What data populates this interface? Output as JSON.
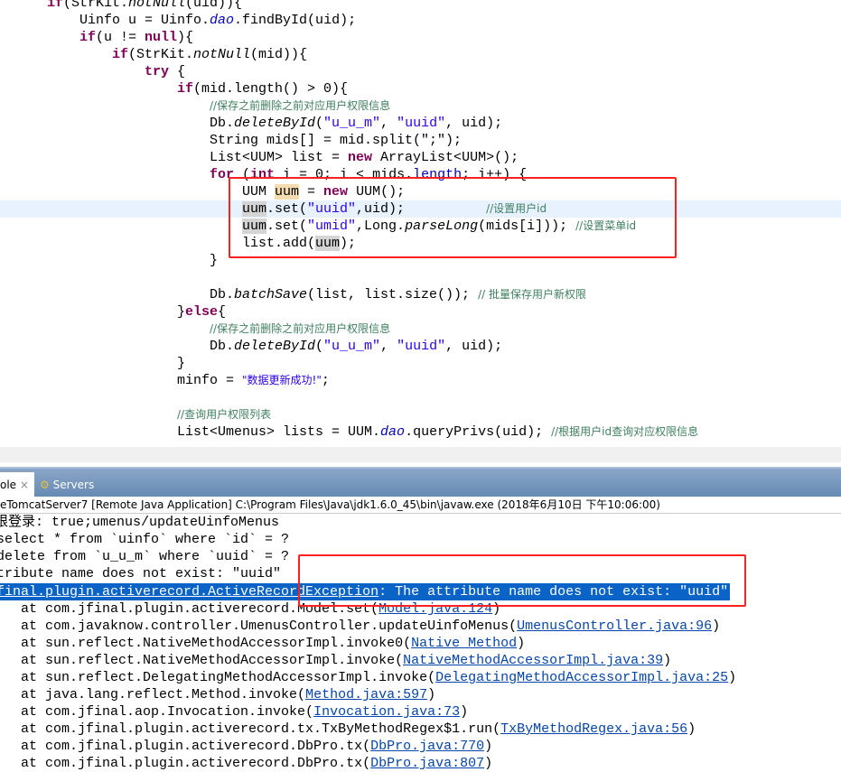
{
  "code": {
    "l0": "if(StrKit.notNull(uid)){",
    "l1": "Uinfo u = Uinfo.dao.findById(uid);",
    "l3": "if(StrKit.notNull(mid)){",
    "l6": "//保存之前删除之前对应用户权限信息",
    "l8": "String mids[] = mid.split(\";\");",
    "l11c": "//设置用户id",
    "l12c": "//设置菜单id",
    "l16c": "// 批量保存用户新权限",
    "l18": "//保存之前删除之前对应用户权限信息",
    "l21s": "\"数据更新成功!\"",
    "l23": "//查询用户权限列表",
    "l24c": "//根据用户id查询对应权限信息"
  },
  "console": {
    "tabs": [
      {
        "label": "ole",
        "close": "×"
      },
      {
        "label": "Servers"
      }
    ],
    "info": "eTomcatServer7 [Remote Java Application] C:\\Program Files\\Java\\jdk1.6.0_45\\bin\\javaw.exe (2018年6月10日 下午10:06:00)",
    "lines": [
      "限登录: true;umenus/updateUinfoMenus",
      "select * from `uinfo` where `id` = ?",
      "delete from `u_u_m` where `uuid` = ?",
      "ttribute name does not exist: \"uuid\""
    ],
    "exception_link": "final.plugin.activerecord.ActiveRecordException",
    "exception_msg": ": The attribute name does not exist: \"uuid\"",
    "stack": [
      {
        "at": "    at com.jfinal.plugin.activerecord.Model.set(",
        "link": "Model.java:124"
      },
      {
        "at": "    at com.javaknow.controller.UmenusController.updateUinfoMenus(",
        "link": "UmenusController.java:96"
      },
      {
        "at": "    at sun.reflect.NativeMethodAccessorImpl.invoke0(",
        "link": "Native Method"
      },
      {
        "at": "    at sun.reflect.NativeMethodAccessorImpl.invoke(",
        "link": "NativeMethodAccessorImpl.java:39"
      },
      {
        "at": "    at sun.reflect.DelegatingMethodAccessorImpl.invoke(",
        "link": "DelegatingMethodAccessorImpl.java:25"
      },
      {
        "at": "    at java.lang.reflect.Method.invoke(",
        "link": "Method.java:597"
      },
      {
        "at": "    at com.jfinal.aop.Invocation.invoke(",
        "link": "Invocation.java:73"
      },
      {
        "at": "    at com.jfinal.plugin.activerecord.tx.TxByMethodRegex$1.run(",
        "link": "TxByMethodRegex.java:56"
      },
      {
        "at": "    at com.jfinal.plugin.activerecord.DbPro.tx(",
        "link": "DbPro.java:770"
      },
      {
        "at": "    at com.jfinal.plugin.activerecord.DbPro.tx(",
        "link": "DbPro.java:807"
      }
    ]
  },
  "colors": {
    "keyword": "#7f0055",
    "string": "#2a00ff",
    "comment": "#3f7f5f",
    "highlight_box": "#ff2020",
    "selection": "#0a64c8"
  }
}
